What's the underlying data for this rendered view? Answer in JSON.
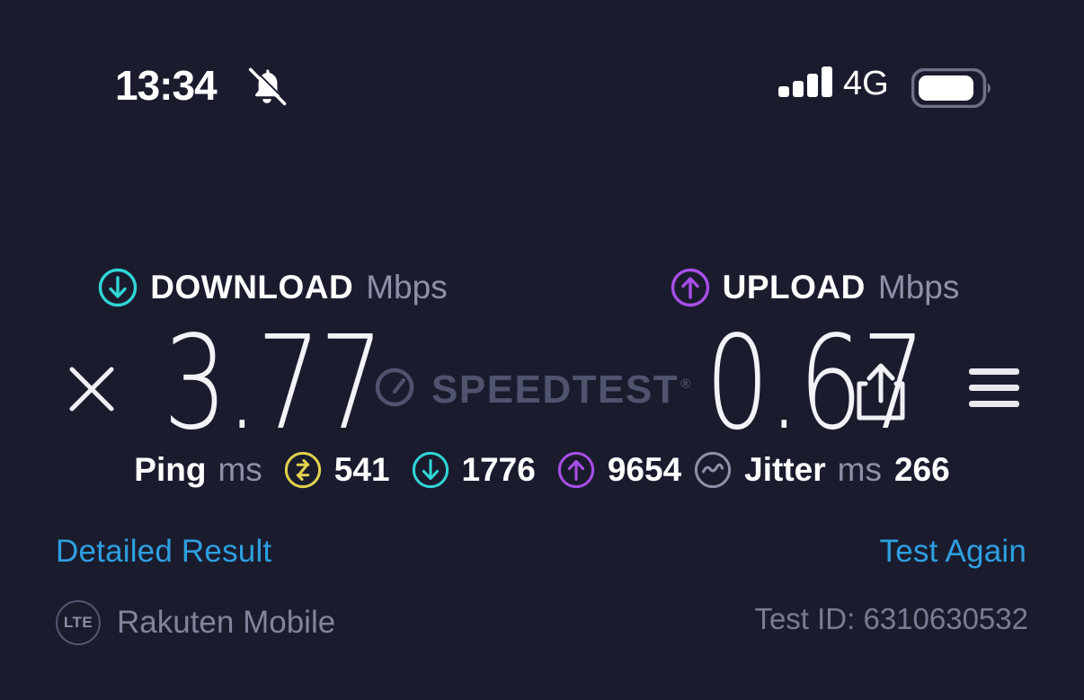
{
  "status_bar": {
    "time": "13:34",
    "bell_icon": "bell-muted-icon",
    "signal_icon": "signal-bars-icon",
    "network_type": "4G",
    "battery_icon": "battery-icon"
  },
  "header": {
    "close_icon": "close-icon",
    "brand": "SPEEDTEST",
    "trademark": "®",
    "logo_icon": "speedometer-icon",
    "share_icon": "share-icon",
    "menu_icon": "hamburger-menu-icon"
  },
  "results": {
    "download": {
      "icon": "download-arrow-icon",
      "title": "DOWNLOAD",
      "unit": "Mbps",
      "value": "3.77",
      "color": "#31d6d6"
    },
    "upload": {
      "icon": "upload-arrow-icon",
      "title": "UPLOAD",
      "unit": "Mbps",
      "value": "0.67",
      "color": "#aa4ee8"
    }
  },
  "sub_metrics": {
    "ping": {
      "label": "Ping",
      "unit": "ms",
      "icon": "latency-icon",
      "icon_color": "#e3d14e",
      "value": "541"
    },
    "ping_download": {
      "icon": "download-arrow-icon",
      "icon_color": "#31d6d6",
      "value": "1776"
    },
    "ping_upload": {
      "icon": "upload-arrow-icon",
      "icon_color": "#aa4ee8",
      "value": "9654"
    },
    "jitter": {
      "icon": "jitter-wave-icon",
      "icon_color": "#8e91a8",
      "label": "Jitter",
      "unit": "ms",
      "value": "266"
    }
  },
  "actions": {
    "detailed_result": "Detailed Result",
    "test_again": "Test Again",
    "link_color": "#2e9fe0"
  },
  "footer": {
    "connection_badge": "LTE",
    "carrier": "Rakuten Mobile",
    "test_id": "Test ID: 6310630532"
  },
  "theme": {
    "background": "#1a1c2e",
    "text_primary": "#ffffff",
    "text_muted": "#8e91a8"
  }
}
